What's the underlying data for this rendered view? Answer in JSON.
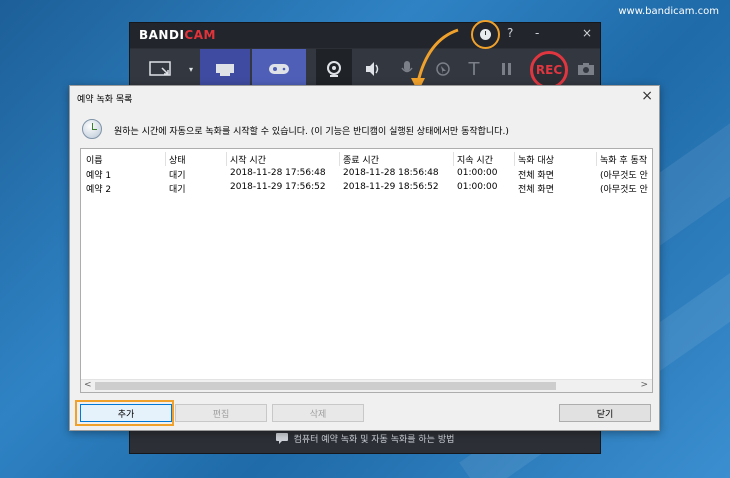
{
  "watermark": "www.bandicam.com",
  "bandicam": {
    "logo_main": "BANDI",
    "logo_accent": "CAM",
    "help_label": "?",
    "minimize_label": "-",
    "close_label": "×",
    "rec_label": "REC",
    "text_tool_label": "T",
    "footer_text": "컴퓨터 예약 녹화 및 자동 녹화를 하는 방법"
  },
  "dialog": {
    "title": "예약 녹화 목록",
    "close_label": "×",
    "info_text": "원하는 시간에 자동으로 녹화를 시작할 수 있습니다. (이 기능은 반디캠이 실행된 상태에서만 동작합니다.)",
    "columns": [
      "이름",
      "상태",
      "시작 시간",
      "종료 시간",
      "지속 시간",
      "녹화 대상",
      "녹화 후 동작"
    ],
    "rows": [
      [
        "예약 1",
        "대기",
        "2018-11-28 17:56:48",
        "2018-11-28 18:56:48",
        "01:00:00",
        "전체 화면",
        "(아무것도 안"
      ],
      [
        "예약 2",
        "대기",
        "2018-11-29 17:56:52",
        "2018-11-29 18:56:52",
        "01:00:00",
        "전체 화면",
        "(아무것도 안"
      ]
    ],
    "buttons": {
      "add": "추가",
      "edit": "편집",
      "delete": "삭제",
      "close": "닫기"
    },
    "scroll_left": "<",
    "scroll_right": ">"
  },
  "colors": {
    "highlight": "#f0a12b",
    "rec": "#e03640"
  }
}
